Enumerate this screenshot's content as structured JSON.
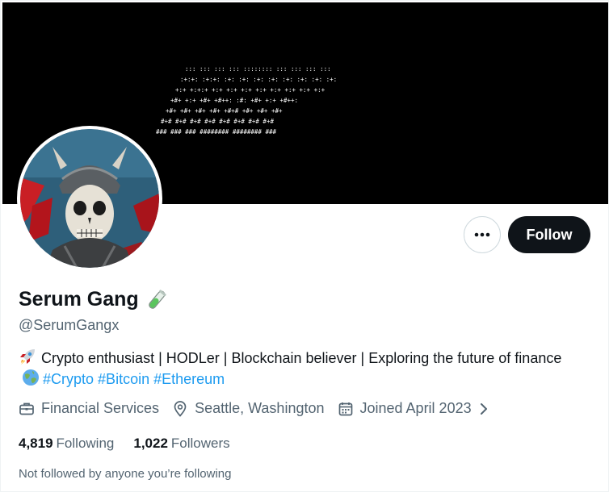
{
  "banner": {
    "art_text_rows": [
      ":::  :::   :::  :::     ::::::::   :::   :::   :::  :::",
      ":+:+: :+:+:  :+:  :+:     :+:    :+:  :+:  :+:  :+:  :+:",
      "+:+ +:+:+ +:+  +:+ +:+    +:+       +:+   +:+  +:+ +:+",
      "+#+  +:+  +#+  +#++:      :#:        +#+  +:+  +#++:",
      "+#+      +#+  +#+     +#+  +#+#   +#+  +#+   +#+",
      "#+#      #+#  #+#     #+#   #+#  #+#  #+#    #+#",
      "###      ###  ###     ########   ########    ###"
    ]
  },
  "profile": {
    "display_name": "Serum Gang",
    "name_emoji": "test-tube-icon",
    "handle": "@SerumGangx",
    "bio_text": "Crypto enthusiast | HODLer | Blockchain believer | Exploring the future of finance",
    "bio_emoji_start": "rocket-icon",
    "bio_emoji_globe": "globe-icon",
    "hashtags": [
      "#Crypto",
      "#Bitcoin",
      "#Ethereum"
    ],
    "category": "Financial Services",
    "location": "Seattle, Washington",
    "joined": "Joined April 2023",
    "following_count": "4,819",
    "following_label": "Following",
    "followers_count": "1,022",
    "followers_label": "Followers",
    "not_followed_note": "Not followed by anyone you’re following"
  },
  "actions": {
    "follow_label": "Follow",
    "more_icon": "more-horizontal-icon"
  },
  "colors": {
    "accent": "#1d9bf0",
    "text": "#0f1419",
    "muted": "#536471",
    "button_dark": "#0f1419"
  }
}
